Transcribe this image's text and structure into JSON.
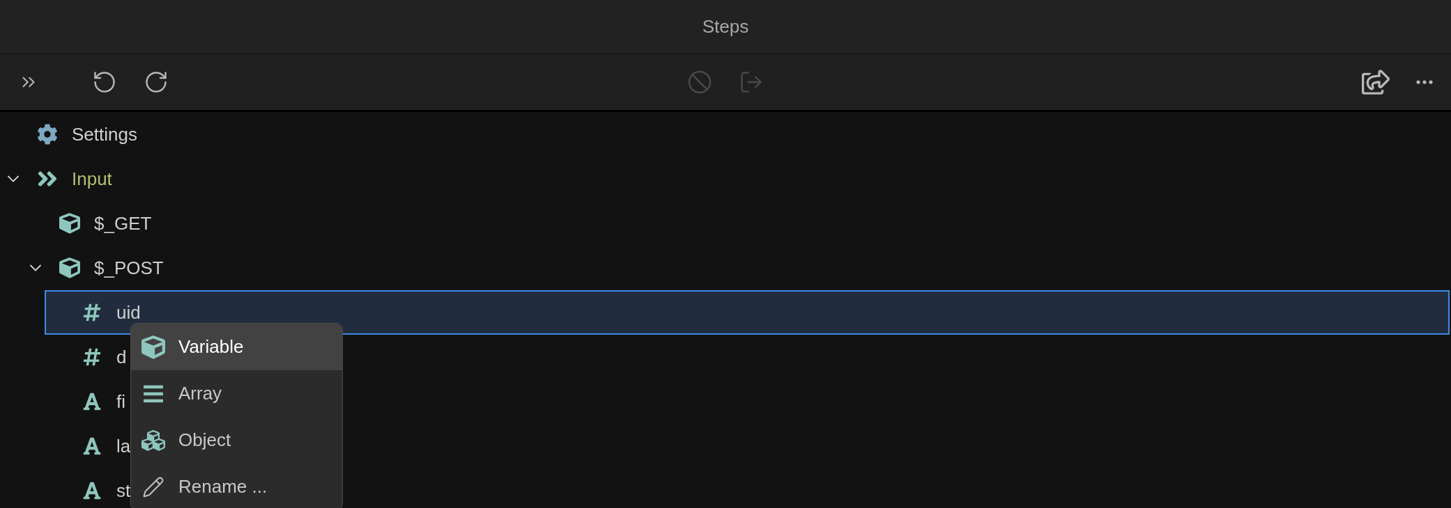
{
  "window": {
    "title": "Steps"
  },
  "toolbar": {
    "left": [
      {
        "kind": "expand",
        "disabled": false
      },
      {
        "kind": "undo",
        "disabled": false
      },
      {
        "kind": "redo",
        "disabled": false
      }
    ],
    "center": [
      {
        "kind": "block",
        "disabled": true
      },
      {
        "kind": "export",
        "disabled": true
      }
    ],
    "right": [
      {
        "kind": "share",
        "disabled": false
      },
      {
        "kind": "more",
        "disabled": false
      }
    ]
  },
  "tree": [
    {
      "kind": "settings",
      "label": "Settings",
      "selected": false
    },
    {
      "kind": "input",
      "label": "Input",
      "selected": false,
      "expanded": true,
      "children": [
        {
          "kind": "object",
          "label": "$_GET",
          "selected": false
        },
        {
          "kind": "object",
          "label": "$_POST",
          "selected": false,
          "expanded": true,
          "children": [
            {
              "kind": "number",
              "label": "uid",
              "selected": true
            },
            {
              "kind": "number",
              "label": "d",
              "selected": false
            },
            {
              "kind": "text",
              "label": "fi",
              "selected": false
            },
            {
              "kind": "text",
              "label": "la",
              "selected": false
            },
            {
              "kind": "text",
              "label": "st",
              "selected": false
            }
          ]
        }
      ]
    }
  ],
  "context_menu": [
    {
      "kind": "variable",
      "label": "Variable",
      "selected": true
    },
    {
      "kind": "array",
      "label": "Array",
      "selected": false
    },
    {
      "kind": "object",
      "label": "Object",
      "selected": false
    },
    {
      "kind": "rename",
      "label": "Rename ...",
      "selected": false
    }
  ]
}
